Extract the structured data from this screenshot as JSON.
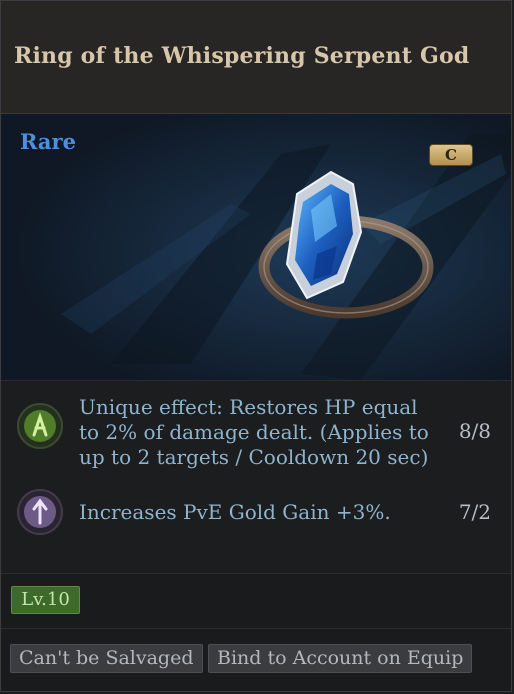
{
  "item": {
    "name": "Ring of the Whispering Serpent God",
    "rarity": "Rare",
    "grade": "C",
    "level": "Lv.10"
  },
  "effects": [
    {
      "icon": "serpent-rune-icon",
      "text_lines": [
        "Unique effect: Restores HP equal",
        "to 2% of damage dealt. (Applies to",
        "up to 2 targets / Cooldown 20 sec)"
      ],
      "value": "8/8"
    },
    {
      "icon": "gold-gain-rune-icon",
      "text_lines": [
        "Increases PvE Gold Gain +3%."
      ],
      "value": "7/2"
    }
  ],
  "tags": [
    "Can't be Salvaged",
    "Bind to Account on Equip"
  ],
  "colors": {
    "rarity": "#4f8fdc",
    "effect_text": "#8eb4ce",
    "level_badge": "#3d6a2b",
    "grade_badge": "#d2b477"
  }
}
